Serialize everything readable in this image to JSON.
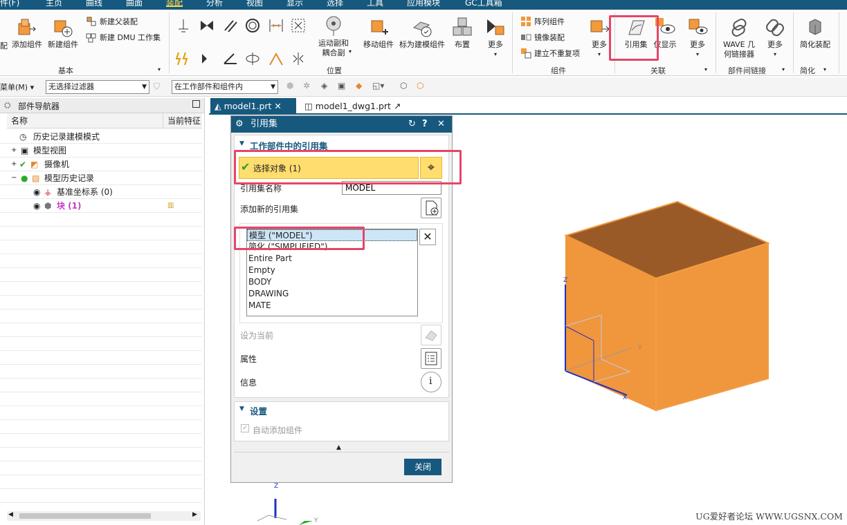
{
  "menubar": {
    "tabs": [
      "件(F)",
      "主页",
      "曲线",
      "曲面",
      "装配",
      "分析",
      "视图",
      "显示",
      "选择",
      "工具",
      "应用模块",
      "GC工具箱"
    ],
    "active_index": 4
  },
  "ribbon": {
    "basic": {
      "label": "基本",
      "add_component": "添加组件",
      "new_component": "新建组件",
      "new_parent": "新建父装配",
      "new_dmu": "新建 DMU 工作集",
      "left_fragment": "配"
    },
    "position": {
      "label": "位置",
      "motion_pair": "运动副和\n耦合副",
      "move_component": "移动组件",
      "model_as_component": "标为建模组件",
      "layout": "布置",
      "more": "更多"
    },
    "component": {
      "label": "组件",
      "array": "阵列组件",
      "mirror": "镜像装配",
      "no_repeat": "建立不重复项",
      "more": "更多"
    },
    "association": {
      "label": "关联",
      "reference_set": "引用集",
      "show": "仅显示",
      "more": "更多"
    },
    "interpart": {
      "label": "部件间链接",
      "wave": "WAVE 几\n何链接器",
      "more": "更多"
    },
    "simplify": {
      "label": "简化",
      "simplified_assembly": "简化装配"
    }
  },
  "toolbar": {
    "menu_label": "菜单(M)",
    "filter_value": "无选择过滤器",
    "scope_value": "在工作部件和组件内"
  },
  "navigator": {
    "title": "部件导航器",
    "col_name": "名称",
    "col_feature": "当前特征",
    "items": [
      {
        "label": "历史记录建模模式"
      },
      {
        "label": "模型视图"
      },
      {
        "label": "摄像机"
      },
      {
        "label": "模型历史记录"
      },
      {
        "label": "基准坐标系 (0)"
      },
      {
        "label": "块 (1)"
      }
    ],
    "status_color": "#c23cc2"
  },
  "tabs": [
    {
      "label": "model1.prt"
    },
    {
      "label": "model1_dwg1.prt"
    }
  ],
  "dialog": {
    "title": "引用集",
    "section_title": "工作部件中的引用集",
    "select_object": "选择对象 (1)",
    "refset_name_label": "引用集名称",
    "refset_name_value": "MODEL",
    "add_new_label": "添加新的引用集",
    "list": [
      "模型 (\"MODEL\")",
      "简化 (\"SIMPLIFIED\")",
      "Entire Part",
      "Empty",
      "BODY",
      "DRAWING",
      "MATE"
    ],
    "selected_index": 0,
    "set_current": "设为当前",
    "properties": "属性",
    "info": "信息",
    "settings_title": "设置",
    "auto_add": "自动添加组件",
    "close": "关闭"
  },
  "viewport": {
    "axis_labels": {
      "z": "Z",
      "y": "Y",
      "x": "X"
    }
  },
  "colors": {
    "accent": "#17597e",
    "highlight": "#ffdd6e",
    "annotation": "#e64567",
    "cube_face": "#f0963c",
    "cube_top": "#9a5a28"
  },
  "watermark": "UG爱好者论坛 WWW.UGSNX.COM"
}
